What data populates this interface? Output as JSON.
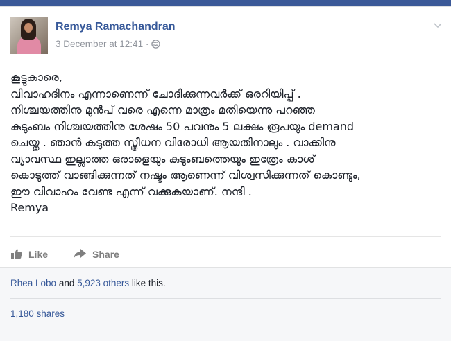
{
  "post": {
    "author": "Remya Ramachandran",
    "timestamp": "3 December at 12:41",
    "separator": "·",
    "privacy_icon": "public-globe-icon",
    "lines": [
      "കൂട്ടുകാരെ,",
      "വിവാഹദിനം എന്നാണെന്ന് ചോദിക്കുന്നവർക്ക് ഒരറിയിപ്പ് .",
      "നിശ്ചയത്തിനു മുൻപ് വരെ എന്നെ മാത്രം മതിയെന്നു പറഞ്ഞ",
      "കുടുംബം നിശ്ചയത്തിനു ശേഷം 50 പവനും 5 ലക്ഷം രൂപയും demand",
      "ചെയ്തു . ഞാൻ കടുത്ത സ്ത്രീധന വിരോധി ആയതിനാലും . വാക്കിനു",
      "വ്യാവസ്ഥ ഇല്ലാത്ത ഒരാളെയും കുടുംബത്തെയും ഇത്രേം കാശ്",
      "കൊടുത്ത് വാങ്ങിക്കുന്നത് നഷ്ടം ആണെന്ന് വിശ്വസിക്കുന്നത് കൊണ്ടും,",
      "ഈ വിവാഹം വേണ്ട എന്ന് വക്കുകയാണ്. നന്ദി .",
      "Remya"
    ]
  },
  "actions": {
    "like_label": "Like",
    "share_label": "Share"
  },
  "footer": {
    "liker_name": "Rhea Lobo",
    "and_text": " and ",
    "others_text": "5,923 others",
    "like_suffix": " like this.",
    "shares_text": "1,180 shares"
  },
  "colors": {
    "brand": "#3b5998",
    "link": "#365899",
    "muted": "#90949c"
  }
}
